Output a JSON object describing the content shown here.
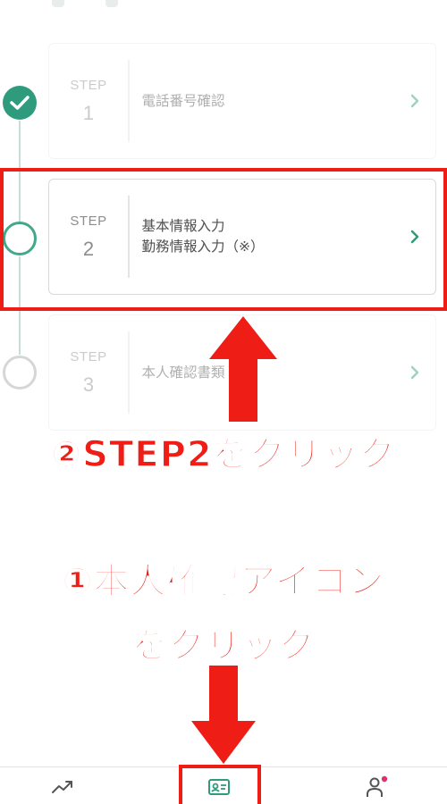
{
  "steps": [
    {
      "label": "STEP",
      "number": "1",
      "title_lines": [
        "電話番号確認"
      ],
      "status": "done"
    },
    {
      "label": "STEP",
      "number": "2",
      "title_lines": [
        "基本情報入力",
        "勤務情報入力（※）"
      ],
      "status": "current"
    },
    {
      "label": "STEP",
      "number": "3",
      "title_lines": [
        "本人確認書類"
      ],
      "status": "todo"
    }
  ],
  "annotations": {
    "step2_click": "②STEP2をクリック",
    "id_icon_line1": "①本人確認アイコン",
    "id_icon_line2": "をクリック"
  },
  "nav": {
    "items": [
      {
        "icon": "trend-chart-icon"
      },
      {
        "icon": "id-card-icon"
      },
      {
        "icon": "account-icon"
      }
    ]
  },
  "colors": {
    "accent": "#2e9b7c",
    "highlight": "#ee1d16",
    "notification": "#e0306a"
  }
}
